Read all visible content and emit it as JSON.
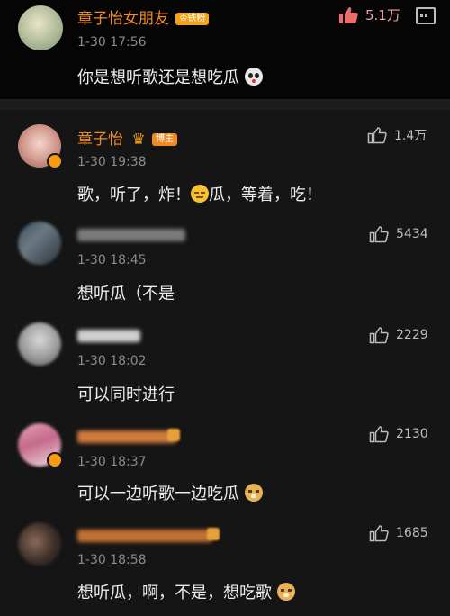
{
  "original": {
    "name": "章子怡女朋友",
    "fan_badge": "铁粉",
    "time": "1-30 17:56",
    "text": "你是想听歌还是想吃瓜",
    "likes": "5.1万"
  },
  "replies": [
    {
      "name": "章子怡",
      "badge": "博主",
      "time": "1-30 19:38",
      "text_a": "歌，听了，炸！",
      "text_b": "瓜，等着，吃！",
      "likes": "1.4万"
    },
    {
      "time": "1-30 18:45",
      "text": "想听瓜（不是",
      "likes": "5434"
    },
    {
      "time": "1-30 18:02",
      "text": "可以同时进行",
      "likes": "2229"
    },
    {
      "time": "1-30 18:37",
      "text": "可以一边听歌一边吃瓜",
      "likes": "2130"
    },
    {
      "time": "1-30 18:58",
      "text": "想听瓜，啊，不是，想吃歌",
      "likes": "1685"
    }
  ]
}
